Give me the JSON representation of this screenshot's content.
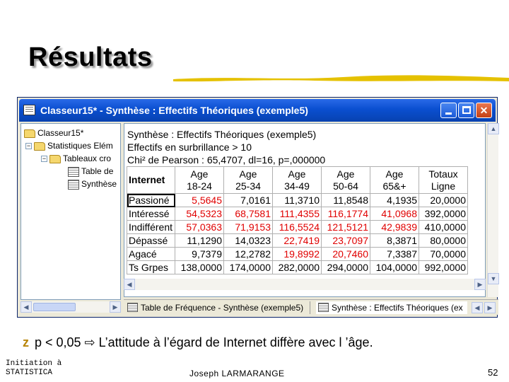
{
  "slide": {
    "title": "Résultats",
    "bullet_marker": "z",
    "bullet_text": "p < 0,05 ⇨ L’attitude à l’égard de Internet diffère avec l ’âge.",
    "footer_left_1": "Initiation à",
    "footer_left_2": "STATISTICA",
    "footer_center": "Joseph LARMARANGE",
    "page_number": "52"
  },
  "window": {
    "title": "Classeur15* - Synthèse : Effectifs Théoriques (exemple5)"
  },
  "tree": {
    "items": [
      {
        "label": "Classeur15*"
      },
      {
        "label": "Statistiques Elém"
      },
      {
        "label": "Tableaux cro"
      },
      {
        "label": "Table de"
      },
      {
        "label": "Synthèse"
      }
    ]
  },
  "content": {
    "line1": "Synthèse : Effectifs Théoriques (exemple5)",
    "line2": "Effectifs en surbrillance > 10",
    "line3": "Chi² de Pearson : 65,4707, dl=16, p=,000000",
    "corner": "Internet",
    "columns": [
      {
        "top": "Age",
        "bottom": "18-24"
      },
      {
        "top": "Age",
        "bottom": "25-34"
      },
      {
        "top": "Age",
        "bottom": "34-49"
      },
      {
        "top": "Age",
        "bottom": "50-64"
      },
      {
        "top": "Age",
        "bottom": "65&+"
      },
      {
        "top": "Totaux",
        "bottom": "Ligne"
      }
    ],
    "rows": [
      {
        "label": "Passioné",
        "values": [
          "5,5645",
          "7,0161",
          "11,3710",
          "11,8548",
          "4,1935",
          "20,0000"
        ],
        "colors": [
          "red",
          "black",
          "black",
          "black",
          "black",
          "black"
        ]
      },
      {
        "label": "Intéressé",
        "values": [
          "54,5323",
          "68,7581",
          "111,4355",
          "116,1774",
          "41,0968",
          "392,0000"
        ],
        "colors": [
          "red",
          "red",
          "red",
          "red",
          "red",
          "black"
        ]
      },
      {
        "label": "Indifférent",
        "values": [
          "57,0363",
          "71,9153",
          "116,5524",
          "121,5121",
          "42,9839",
          "410,0000"
        ],
        "colors": [
          "red",
          "red",
          "red",
          "red",
          "red",
          "black"
        ]
      },
      {
        "label": "Dépassé",
        "values": [
          "11,1290",
          "14,0323",
          "22,7419",
          "23,7097",
          "8,3871",
          "80,0000"
        ],
        "colors": [
          "black",
          "black",
          "red",
          "red",
          "black",
          "black"
        ]
      },
      {
        "label": "Agacé",
        "values": [
          "9,7379",
          "12,2782",
          "19,8992",
          "20,7460",
          "7,3387",
          "70,0000"
        ],
        "colors": [
          "black",
          "black",
          "red",
          "red",
          "black",
          "black"
        ]
      },
      {
        "label": "Ts Grpes",
        "values": [
          "138,0000",
          "174,0000",
          "282,0000",
          "294,0000",
          "104,0000",
          "992,0000"
        ],
        "colors": [
          "black",
          "black",
          "black",
          "black",
          "black",
          "black"
        ]
      }
    ]
  },
  "sheet_tabs": {
    "tab1": "Table de Fréquence - Synthèse (exemple5)",
    "tab2": "Synthèse : Effectifs Théoriques (ex"
  },
  "colors": {
    "highlight_value": "#e00000",
    "titlebar": "#0a4fd0",
    "accent_bullet": "#b8860b"
  }
}
